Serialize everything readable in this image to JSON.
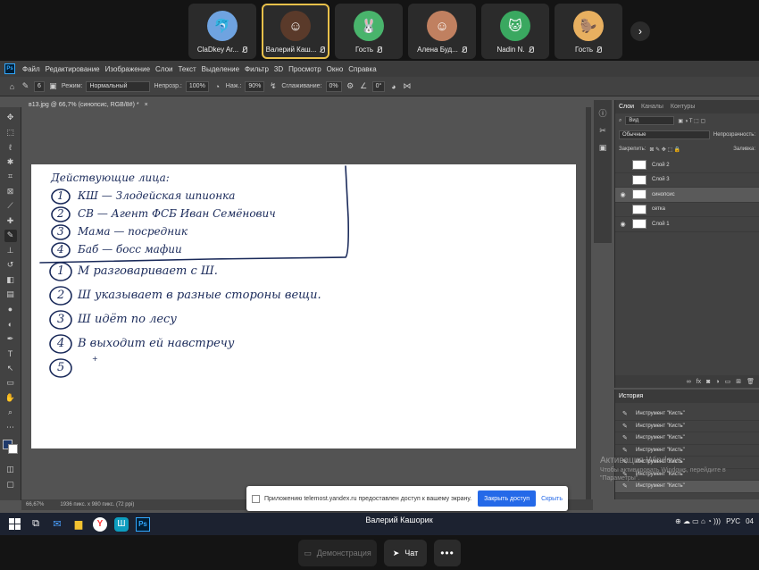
{
  "participants": [
    {
      "name": "ClaDkey Ar...",
      "avatar_icon": "dolphin-icon",
      "avatar_color": "#6fa3e0",
      "active": false
    },
    {
      "name": "Валерий Каш...",
      "avatar_icon": "person-photo-icon",
      "avatar_color": "#5a3a2a",
      "active": true
    },
    {
      "name": "Гость",
      "avatar_icon": "rabbit-icon",
      "avatar_color": "#49b46c",
      "active": false
    },
    {
      "name": "Алена Буд...",
      "avatar_icon": "person-photo-icon",
      "avatar_color": "#c08060",
      "active": false
    },
    {
      "name": "Nadin N.",
      "avatar_icon": "cat-icon",
      "avatar_color": "#3aa860",
      "active": false
    },
    {
      "name": "Гость",
      "avatar_icon": "beaver-icon",
      "avatar_color": "#e8b060",
      "active": false
    }
  ],
  "ps": {
    "menu": [
      "Файл",
      "Редактирование",
      "Изображение",
      "Слои",
      "Текст",
      "Выделение",
      "Фильтр",
      "3D",
      "Просмотр",
      "Окно",
      "Справка"
    ],
    "options": {
      "brush_size": "6",
      "mode_label": "Режим:",
      "mode_value": "Нормальный",
      "opacity_label": "Непрозр.:",
      "opacity_value": "100%",
      "pressure_label": "Наж.:",
      "pressure_value": "90%",
      "smoothing_label": "Сглаживание:",
      "smoothing_value": "0%",
      "angle_value": "0°"
    },
    "doc_tab": "в13.jpg @ 66,7% (синопсис, RGB/8#) *",
    "status_zoom": "66,67%",
    "status_size": "1936 пикс. x 980 пикс. (72 ppi)",
    "layers": {
      "tabs": [
        "Слои",
        "Каналы",
        "Контуры"
      ],
      "filter_value": "Вид",
      "blend_value": "Обычные",
      "opacity_label": "Непрозрачность:",
      "lock_label": "Закрепить:",
      "fill_label": "Заливка:",
      "items": [
        {
          "name": "Слой 2",
          "visible": false,
          "selected": false
        },
        {
          "name": "Слой 3",
          "visible": false,
          "selected": false
        },
        {
          "name": "синопсис",
          "visible": true,
          "selected": true
        },
        {
          "name": "сетка",
          "visible": false,
          "selected": false
        },
        {
          "name": "Слой 1",
          "visible": true,
          "selected": false
        }
      ]
    },
    "history": {
      "title": "История",
      "items": [
        "Инструмент \"Кисть\"",
        "Инструмент \"Кисть\"",
        "Инструмент \"Кисть\"",
        "Инструмент \"Кисть\"",
        "Инструмент \"Кисть\"",
        "Инструмент \"Кисть\"",
        "Инструмент \"Кисть\""
      ]
    }
  },
  "canvas": {
    "heading": "Действующие лица:",
    "characters": [
      {
        "num": "1",
        "text": "КШ — Злодейская шпионка"
      },
      {
        "num": "2",
        "text": "СВ — Агент ФСБ Иван Семёнович"
      },
      {
        "num": "3",
        "text": "Мама — посредник"
      },
      {
        "num": "4",
        "text": "Баб — босс мафии"
      }
    ],
    "plot": [
      {
        "num": "1",
        "text": "М разговаривает с Ш."
      },
      {
        "num": "2",
        "text": "Ш указывает в разные стороны вещи."
      },
      {
        "num": "3",
        "text": "Ш идёт по лесу"
      },
      {
        "num": "4",
        "text": "В выходит ей навстречу"
      },
      {
        "num": "5",
        "text": ""
      }
    ]
  },
  "watermark": {
    "line1": "Активация Windows",
    "line2": "Чтобы активировать Windows, перейдите в",
    "line3": "\"Параметры\"."
  },
  "share_notice": {
    "text": "Приложению telemost.yandex.ru предоставлен доступ к вашему экрану.",
    "close_button": "Закрыть доступ",
    "hide_link": "Скрыть"
  },
  "taskbar": {
    "lang": "РУС",
    "clock": "04"
  },
  "presenter_name": "Валерий Кашорик",
  "controls": {
    "demo_label": "Демонстрация",
    "chat_label": "Чат"
  }
}
